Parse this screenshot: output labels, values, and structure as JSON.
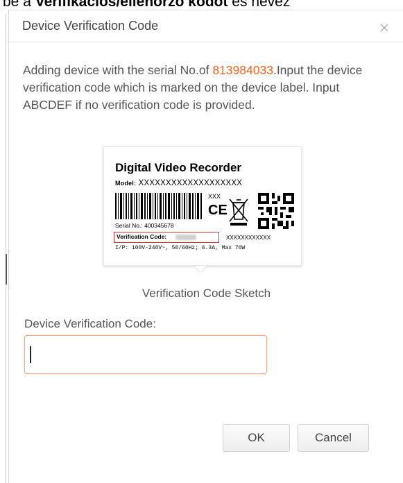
{
  "background": {
    "bold_text": "Verifikációs/ellenőrző kódot",
    "prefix": "be a ",
    "suffix": " és nevez"
  },
  "dialog": {
    "title": "Device Verification Code",
    "close_icon": "close-icon",
    "message_before": "Adding device with the serial No.of ",
    "serial_number": "813984033",
    "message_after": ".Input the device verification code which is marked on the device label. Input ABCDEF if no verification code is provided.",
    "label_sketch": {
      "title": "Digital Video Recorder",
      "model_label": "Model:",
      "model_value": "XXXXXXXXXXXXXXXXXXX",
      "small_xxx": "XXX",
      "ce_mark": "CE",
      "serial_label": "Serial No.:",
      "serial_value": "400345678",
      "verification_label": "Verification Code:",
      "right_xxx": "XXXXXXXXXXXX",
      "power_line": "I/P: 100V-240V~, 50/60Hz; 6.3A, Max 70W"
    },
    "sketch_caption": "Verification Code Sketch",
    "field_label": "Device Verification Code:",
    "input_value": "",
    "ok_label": "OK",
    "cancel_label": "Cancel"
  },
  "colors": {
    "accent": "#f26522",
    "verification_highlight": "#e23030",
    "input_focus_border": "#f0a98a"
  }
}
